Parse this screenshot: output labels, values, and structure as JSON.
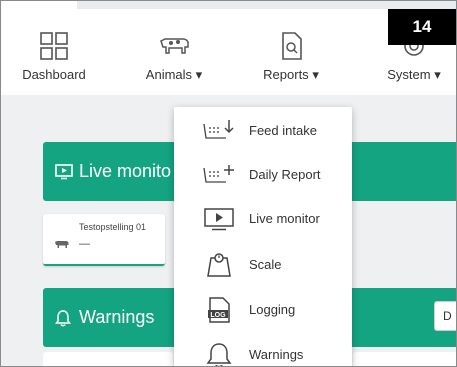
{
  "badge": "14",
  "nav": {
    "dashboard": "Dashboard",
    "animals": "Animals",
    "reports": "Reports",
    "system": "System",
    "caret": "▾"
  },
  "panels": {
    "live_monitor_title": "Live monito",
    "warnings_title": "Warnings"
  },
  "card": {
    "title": "Testopstelling 01",
    "value": "—"
  },
  "side_button_label": "D",
  "dropdown": {
    "items": [
      {
        "label": "Feed intake",
        "icon": "feed-intake-icon"
      },
      {
        "label": "Daily Report",
        "icon": "daily-report-icon"
      },
      {
        "label": "Live monitor",
        "icon": "live-monitor-icon"
      },
      {
        "label": "Scale",
        "icon": "scale-icon"
      },
      {
        "label": "Logging",
        "icon": "logging-icon"
      },
      {
        "label": "Warnings",
        "icon": "warnings-icon"
      }
    ]
  },
  "colors": {
    "accent": "#14a482",
    "background": "#eef0f2"
  }
}
